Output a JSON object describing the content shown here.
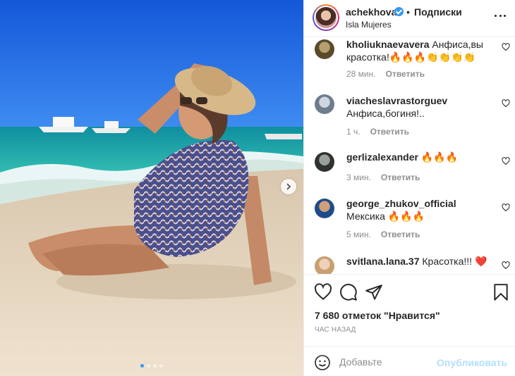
{
  "post": {
    "username": "achekhova",
    "separator": "•",
    "follow_label": "Подписки",
    "location": "Isla Mujeres"
  },
  "comments": [
    {
      "user": "kholiuknaevavera",
      "text": "Анфиса,вы красотка!🔥🔥🔥👏👏👏👏",
      "time": "28 мин.",
      "reply": "Ответить"
    },
    {
      "user": "viacheslavrastorguev",
      "text": "Анфиса,богиня!..",
      "time": "1 ч.",
      "reply": "Ответить"
    },
    {
      "user": "gerlizalexander",
      "text": "🔥🔥🔥",
      "time": "3 мин.",
      "reply": "Ответить"
    },
    {
      "user": "george_zhukov_official",
      "text": "Мексика 🔥🔥🔥",
      "time": "5 мин.",
      "reply": "Ответить"
    },
    {
      "user": "svitlana.lana.37",
      "text": "Красотка!!! ❤️",
      "time": "",
      "reply": ""
    }
  ],
  "likes": "7 680 отметок \"Нравится\"",
  "timestamp": "ЧАС НАЗАД",
  "add_comment": {
    "placeholder": "Добавьте",
    "publish_label": "Опубликовать"
  },
  "icons": {
    "like": "heart-icon",
    "comment": "comment-icon",
    "share": "send-icon",
    "save": "bookmark-icon",
    "emoji": "emoji-icon",
    "more": "more-icon",
    "next": "chevron-right-icon"
  },
  "colors": {
    "accent": "#3897f0",
    "publish_disabled": "#b2dffc",
    "muted": "#8e8e8e"
  }
}
